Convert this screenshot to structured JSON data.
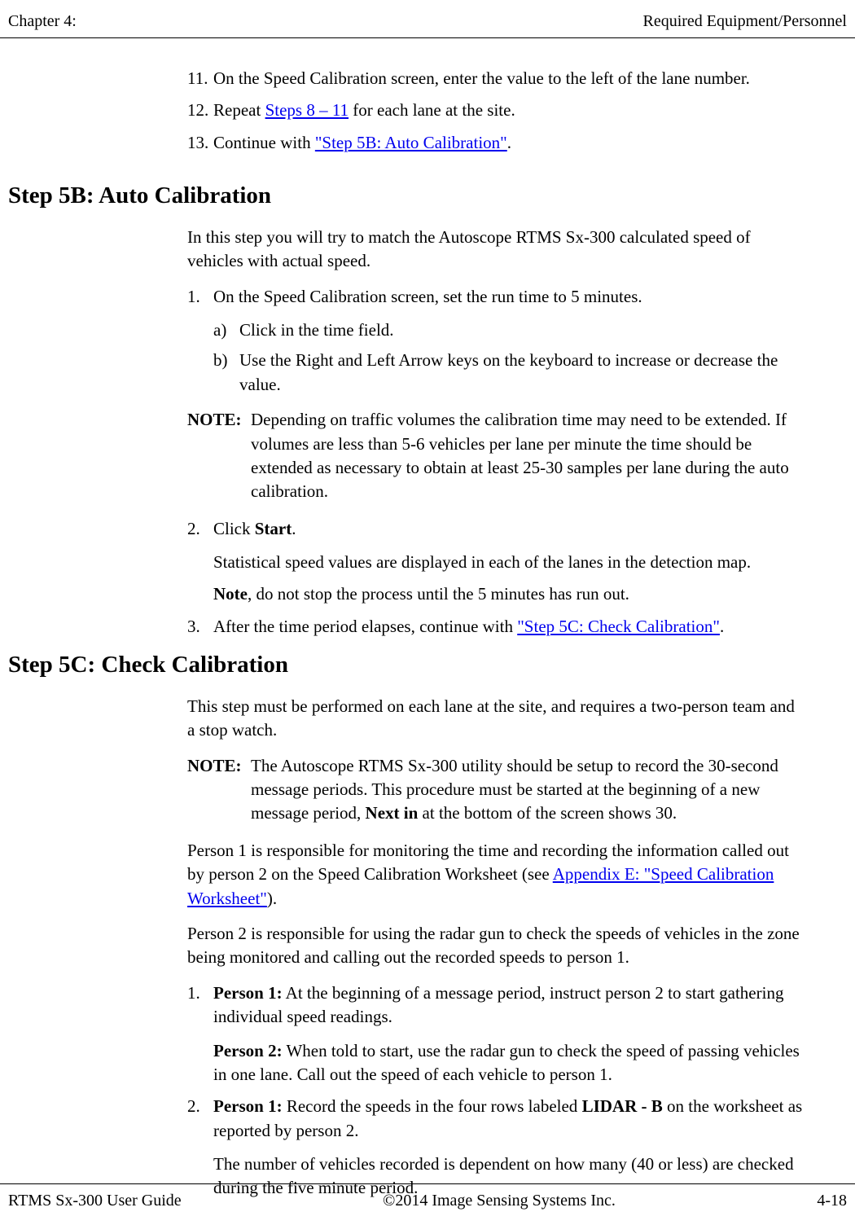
{
  "header": {
    "left": "Chapter 4:",
    "right": "Required Equipment/Personnel"
  },
  "topList": {
    "item11_num": "11.",
    "item11_text": "On the Speed Calibration screen, enter the value to the left of the lane number.",
    "item12_num": "12.",
    "item12_pre": "Repeat ",
    "item12_link": "Steps 8 – 11",
    "item12_post": " for each lane at the site.",
    "item13_num": "13.",
    "item13_pre": " Continue with ",
    "item13_link": "\"Step 5B: Auto Calibration\"",
    "item13_post": "."
  },
  "section5b": {
    "heading": "Step 5B: Auto Calibration",
    "intro": "In this step you will try to match the Autoscope RTMS Sx-300 calculated speed of vehicles with actual speed.",
    "s1_num": "1.",
    "s1_text": "On the Speed Calibration screen, set the run time to 5 minutes.",
    "sa_letter": "a)",
    "sa_text": "Click in the time field.",
    "sb_letter": "b)",
    "sb_text": "Use the Right and Left Arrow keys on the keyboard to increase or decrease the value.",
    "note_label": "NOTE:",
    "note_text": "Depending on traffic volumes the calibration time may need to be extended. If volumes are less than 5-6 vehicles per lane per minute the time should be extended as necessary to obtain at least 25-30 samples per lane during the auto calibration.",
    "s2_num": "2.",
    "s2_pre": "Click ",
    "s2_bold": "Start",
    "s2_post": ".",
    "s2_line1": "Statistical speed values are displayed in each of the lanes in the detection map.",
    "s2_line2_bold": "Note",
    "s2_line2_post": ", do not stop the process until the 5 minutes has run out.",
    "s3_num": "3.",
    "s3_pre": "After the time period elapses, continue with ",
    "s3_link": "\"Step 5C: Check Calibration\"",
    "s3_post": "."
  },
  "section5c": {
    "heading": "Step 5C: Check Calibration",
    "intro": "This step must be performed on each lane at the site, and requires a two-person team and a stop watch.",
    "note_label": "NOTE:",
    "note_pre": "The Autoscope RTMS Sx-300 utility should be setup to record the 30-second message periods. This procedure must be started at the beginning of a new message period, ",
    "note_bold": "Next in",
    "note_post": " at the bottom of the screen shows 30.",
    "p1_pre": "Person 1 is responsible for monitoring the time and recording the information called out by person 2 on the Speed Calibration Worksheet (see ",
    "p1_link": "Appendix E: \"Speed Calibration Worksheet\"",
    "p1_post": ").",
    "p2_text": "Person 2 is responsible for using the radar gun to check the speeds of vehicles in the zone being monitored and calling out the recorded speeds to person 1.",
    "s1_num": "1.",
    "s1_bold": "Person 1:",
    "s1_text": " At the beginning of a message period, instruct person 2 to start gathering individual speed readings.",
    "s1b_bold": "Person 2:",
    "s1b_text": " When told to start, use the radar gun to check the speed of passing vehicles in one lane. Call out the speed of each vehicle to person 1.",
    "s2_num": "2.",
    "s2_bold": "Person 1:",
    "s2_pre": " Record the speeds in the four rows labeled ",
    "s2_bold2": "LIDAR - B",
    "s2_post": " on the worksheet as reported by person 2.",
    "s2_line2": "The number of vehicles recorded is dependent on how many (40 or less) are checked during the five minute period."
  },
  "footer": {
    "left": "RTMS Sx-300 User Guide",
    "center": "©2014 Image Sensing Systems Inc.",
    "right": "4-18"
  }
}
